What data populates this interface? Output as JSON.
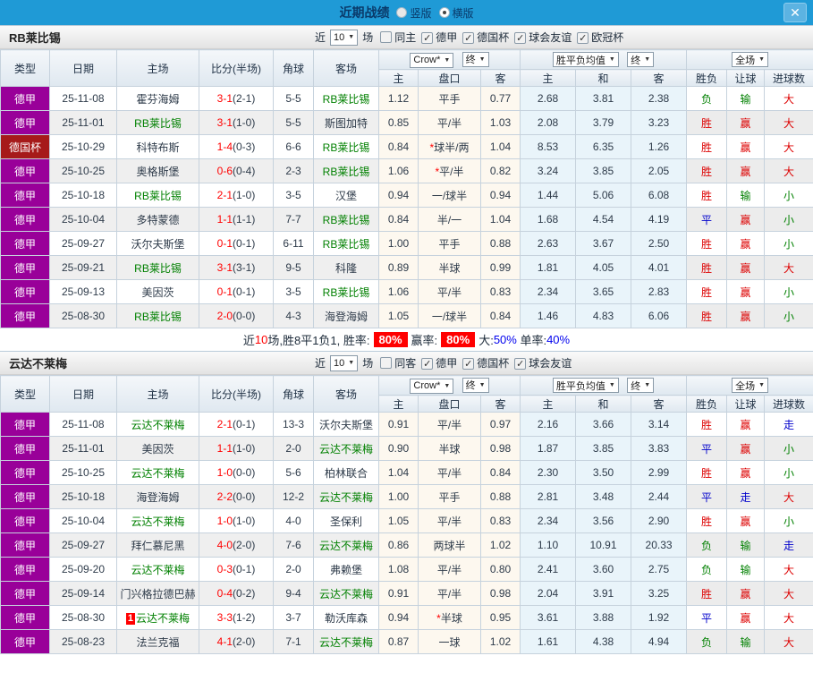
{
  "palette": {
    "header_blue": "#1f9ad6",
    "league_purple": "#990099",
    "cup_darkred": "#a61a1a",
    "win_red": "#dd0000",
    "draw_blue": "#0000cc",
    "lose_green": "#008000",
    "score_red": "#ff0000"
  },
  "header": {
    "title": "近期战绩",
    "vertical": "竖版",
    "horizontal": "横版",
    "close": "✕"
  },
  "controls": {
    "near": "近",
    "count": "10",
    "games": "场",
    "bookmaker": "Crow*",
    "final": "终",
    "mean": "胜平负均值",
    "final2": "终",
    "scope": "全场"
  },
  "cols": {
    "type": "类型",
    "date": "日期",
    "home": "主场",
    "score": "比分(半场)",
    "corners": "角球",
    "away": "客场",
    "odds_home": "主",
    "handicap": "盘口",
    "odds_away": "客",
    "mean_home": "主",
    "mean_draw": "和",
    "mean_away": "客",
    "wdl": "胜负",
    "let_ball": "让球",
    "goals": "进球数"
  },
  "sections": [
    {
      "team": "RB莱比锡",
      "same_label": "同主",
      "leagues": [
        "德甲",
        "德国杯",
        "球会友谊",
        "欧冠杯"
      ],
      "rows": [
        {
          "league": "德甲",
          "badge": "purple",
          "date": "25-11-08",
          "home": "霍芬海姆",
          "home_self": false,
          "home_card": "",
          "score": "3-1",
          "half": "(2-1)",
          "corners": "5-5",
          "away": "RB莱比锡",
          "away_self": true,
          "crow": [
            "1.12",
            "平手",
            "0.77"
          ],
          "mean": [
            "2.68",
            "3.81",
            "2.38"
          ],
          "res": [
            [
              "负",
              "green"
            ],
            [
              "输",
              "green"
            ],
            [
              "大",
              "red"
            ]
          ]
        },
        {
          "league": "德甲",
          "badge": "purple",
          "date": "25-11-01",
          "home": "RB莱比锡",
          "home_self": true,
          "home_card": "",
          "score": "3-1",
          "half": "(1-0)",
          "corners": "5-5",
          "away": "斯图加特",
          "away_self": false,
          "crow": [
            "0.85",
            "平/半",
            "1.03"
          ],
          "mean": [
            "2.08",
            "3.79",
            "3.23"
          ],
          "res": [
            [
              "胜",
              "red"
            ],
            [
              "赢",
              "red"
            ],
            [
              "大",
              "red"
            ]
          ]
        },
        {
          "league": "德国杯",
          "badge": "darkred",
          "date": "25-10-29",
          "home": "科特布斯",
          "home_self": false,
          "home_card": "",
          "score": "1-4",
          "half": "(0-3)",
          "corners": "6-6",
          "away": "RB莱比锡",
          "away_self": true,
          "crow": [
            "0.84",
            "*球半/两",
            "1.04"
          ],
          "mean": [
            "8.53",
            "6.35",
            "1.26"
          ],
          "res": [
            [
              "胜",
              "red"
            ],
            [
              "赢",
              "red"
            ],
            [
              "大",
              "red"
            ]
          ]
        },
        {
          "league": "德甲",
          "badge": "purple",
          "date": "25-10-25",
          "home": "奥格斯堡",
          "home_self": false,
          "home_card": "",
          "score": "0-6",
          "half": "(0-4)",
          "corners": "2-3",
          "away": "RB莱比锡",
          "away_self": true,
          "crow": [
            "1.06",
            "*平/半",
            "0.82"
          ],
          "mean": [
            "3.24",
            "3.85",
            "2.05"
          ],
          "res": [
            [
              "胜",
              "red"
            ],
            [
              "赢",
              "red"
            ],
            [
              "大",
              "red"
            ]
          ]
        },
        {
          "league": "德甲",
          "badge": "purple",
          "date": "25-10-18",
          "home": "RB莱比锡",
          "home_self": true,
          "home_card": "",
          "score": "2-1",
          "half": "(1-0)",
          "corners": "3-5",
          "away": "汉堡",
          "away_self": false,
          "crow": [
            "0.94",
            "一/球半",
            "0.94"
          ],
          "mean": [
            "1.44",
            "5.06",
            "6.08"
          ],
          "res": [
            [
              "胜",
              "red"
            ],
            [
              "输",
              "green"
            ],
            [
              "小",
              "green"
            ]
          ]
        },
        {
          "league": "德甲",
          "badge": "purple",
          "date": "25-10-04",
          "home": "多特蒙德",
          "home_self": false,
          "home_card": "",
          "score": "1-1",
          "half": "(1-1)",
          "corners": "7-7",
          "away": "RB莱比锡",
          "away_self": true,
          "crow": [
            "0.84",
            "半/一",
            "1.04"
          ],
          "mean": [
            "1.68",
            "4.54",
            "4.19"
          ],
          "res": [
            [
              "平",
              "blue"
            ],
            [
              "赢",
              "red"
            ],
            [
              "小",
              "green"
            ]
          ]
        },
        {
          "league": "德甲",
          "badge": "purple",
          "date": "25-09-27",
          "home": "沃尔夫斯堡",
          "home_self": false,
          "home_card": "",
          "score": "0-1",
          "half": "(0-1)",
          "corners": "6-11",
          "away": "RB莱比锡",
          "away_self": true,
          "crow": [
            "1.00",
            "平手",
            "0.88"
          ],
          "mean": [
            "2.63",
            "3.67",
            "2.50"
          ],
          "res": [
            [
              "胜",
              "red"
            ],
            [
              "赢",
              "red"
            ],
            [
              "小",
              "green"
            ]
          ]
        },
        {
          "league": "德甲",
          "badge": "purple",
          "date": "25-09-21",
          "home": "RB莱比锡",
          "home_self": true,
          "home_card": "",
          "score": "3-1",
          "half": "(3-1)",
          "corners": "9-5",
          "away": "科隆",
          "away_self": false,
          "crow": [
            "0.89",
            "半球",
            "0.99"
          ],
          "mean": [
            "1.81",
            "4.05",
            "4.01"
          ],
          "res": [
            [
              "胜",
              "red"
            ],
            [
              "赢",
              "red"
            ],
            [
              "大",
              "red"
            ]
          ]
        },
        {
          "league": "德甲",
          "badge": "purple",
          "date": "25-09-13",
          "home": "美因茨",
          "home_self": false,
          "home_card": "",
          "score": "0-1",
          "half": "(0-1)",
          "corners": "3-5",
          "away": "RB莱比锡",
          "away_self": true,
          "crow": [
            "1.06",
            "平/半",
            "0.83"
          ],
          "mean": [
            "2.34",
            "3.65",
            "2.83"
          ],
          "res": [
            [
              "胜",
              "red"
            ],
            [
              "赢",
              "red"
            ],
            [
              "小",
              "green"
            ]
          ]
        },
        {
          "league": "德甲",
          "badge": "purple",
          "date": "25-08-30",
          "home": "RB莱比锡",
          "home_self": true,
          "home_card": "",
          "score": "2-0",
          "half": "(0-0)",
          "corners": "4-3",
          "away": "海登海姆",
          "away_self": false,
          "crow": [
            "1.05",
            "一/球半",
            "0.84"
          ],
          "mean": [
            "1.46",
            "4.83",
            "6.06"
          ],
          "res": [
            [
              "胜",
              "red"
            ],
            [
              "赢",
              "red"
            ],
            [
              "小",
              "green"
            ]
          ]
        }
      ],
      "summary": [
        [
          "近",
          "dark"
        ],
        [
          "10",
          "red"
        ],
        [
          "场,胜8平1负1, 胜率:",
          "dark"
        ],
        [
          "80%",
          "badge"
        ],
        [
          "赢率:",
          "dark"
        ],
        [
          "80%",
          "badge"
        ],
        [
          "大:",
          "dark"
        ],
        [
          "50%",
          "blue"
        ],
        [
          " 单率:",
          "dark"
        ],
        [
          "40%",
          "blue"
        ]
      ]
    },
    {
      "team": "云达不莱梅",
      "same_label": "同客",
      "leagues": [
        "德甲",
        "德国杯",
        "球会友谊"
      ],
      "rows": [
        {
          "league": "德甲",
          "badge": "purple",
          "date": "25-11-08",
          "home": "云达不莱梅",
          "home_self": true,
          "home_card": "",
          "score": "2-1",
          "half": "(0-1)",
          "corners": "13-3",
          "away": "沃尔夫斯堡",
          "away_self": false,
          "crow": [
            "0.91",
            "平/半",
            "0.97"
          ],
          "mean": [
            "2.16",
            "3.66",
            "3.14"
          ],
          "res": [
            [
              "胜",
              "red"
            ],
            [
              "赢",
              "red"
            ],
            [
              "走",
              "blue"
            ]
          ]
        },
        {
          "league": "德甲",
          "badge": "purple",
          "date": "25-11-01",
          "home": "美因茨",
          "home_self": false,
          "home_card": "",
          "score": "1-1",
          "half": "(1-0)",
          "corners": "2-0",
          "away": "云达不莱梅",
          "away_self": true,
          "crow": [
            "0.90",
            "半球",
            "0.98"
          ],
          "mean": [
            "1.87",
            "3.85",
            "3.83"
          ],
          "res": [
            [
              "平",
              "blue"
            ],
            [
              "赢",
              "red"
            ],
            [
              "小",
              "green"
            ]
          ]
        },
        {
          "league": "德甲",
          "badge": "purple",
          "date": "25-10-25",
          "home": "云达不莱梅",
          "home_self": true,
          "home_card": "",
          "score": "1-0",
          "half": "(0-0)",
          "corners": "5-6",
          "away": "柏林联合",
          "away_self": false,
          "crow": [
            "1.04",
            "平/半",
            "0.84"
          ],
          "mean": [
            "2.30",
            "3.50",
            "2.99"
          ],
          "res": [
            [
              "胜",
              "red"
            ],
            [
              "赢",
              "red"
            ],
            [
              "小",
              "green"
            ]
          ]
        },
        {
          "league": "德甲",
          "badge": "purple",
          "date": "25-10-18",
          "home": "海登海姆",
          "home_self": false,
          "home_card": "",
          "score": "2-2",
          "half": "(0-0)",
          "corners": "12-2",
          "away": "云达不莱梅",
          "away_self": true,
          "crow": [
            "1.00",
            "平手",
            "0.88"
          ],
          "mean": [
            "2.81",
            "3.48",
            "2.44"
          ],
          "res": [
            [
              "平",
              "blue"
            ],
            [
              "走",
              "blue"
            ],
            [
              "大",
              "red"
            ]
          ]
        },
        {
          "league": "德甲",
          "badge": "purple",
          "date": "25-10-04",
          "home": "云达不莱梅",
          "home_self": true,
          "home_card": "",
          "score": "1-0",
          "half": "(1-0)",
          "corners": "4-0",
          "away": "圣保利",
          "away_self": false,
          "crow": [
            "1.05",
            "平/半",
            "0.83"
          ],
          "mean": [
            "2.34",
            "3.56",
            "2.90"
          ],
          "res": [
            [
              "胜",
              "red"
            ],
            [
              "赢",
              "red"
            ],
            [
              "小",
              "green"
            ]
          ]
        },
        {
          "league": "德甲",
          "badge": "purple",
          "date": "25-09-27",
          "home": "拜仁慕尼黑",
          "home_self": false,
          "home_card": "",
          "score": "4-0",
          "half": "(2-0)",
          "corners": "7-6",
          "away": "云达不莱梅",
          "away_self": true,
          "crow": [
            "0.86",
            "两球半",
            "1.02"
          ],
          "mean": [
            "1.10",
            "10.91",
            "20.33"
          ],
          "res": [
            [
              "负",
              "green"
            ],
            [
              "输",
              "green"
            ],
            [
              "走",
              "blue"
            ]
          ]
        },
        {
          "league": "德甲",
          "badge": "purple",
          "date": "25-09-20",
          "home": "云达不莱梅",
          "home_self": true,
          "home_card": "",
          "score": "0-3",
          "half": "(0-1)",
          "corners": "2-0",
          "away": "弗赖堡",
          "away_self": false,
          "crow": [
            "1.08",
            "平/半",
            "0.80"
          ],
          "mean": [
            "2.41",
            "3.60",
            "2.75"
          ],
          "res": [
            [
              "负",
              "green"
            ],
            [
              "输",
              "green"
            ],
            [
              "大",
              "red"
            ]
          ]
        },
        {
          "league": "德甲",
          "badge": "purple",
          "date": "25-09-14",
          "home": "门兴格拉德巴赫",
          "home_self": false,
          "home_card": "",
          "score": "0-4",
          "half": "(0-2)",
          "corners": "9-4",
          "away": "云达不莱梅",
          "away_self": true,
          "crow": [
            "0.91",
            "平/半",
            "0.98"
          ],
          "mean": [
            "2.04",
            "3.91",
            "3.25"
          ],
          "res": [
            [
              "胜",
              "red"
            ],
            [
              "赢",
              "red"
            ],
            [
              "大",
              "red"
            ]
          ]
        },
        {
          "league": "德甲",
          "badge": "purple",
          "date": "25-08-30",
          "home": "云达不莱梅",
          "home_self": true,
          "home_card": "1",
          "score": "3-3",
          "half": "(1-2)",
          "corners": "3-7",
          "away": "勒沃库森",
          "away_self": false,
          "crow": [
            "0.94",
            "*半球",
            "0.95"
          ],
          "mean": [
            "3.61",
            "3.88",
            "1.92"
          ],
          "res": [
            [
              "平",
              "blue"
            ],
            [
              "赢",
              "red"
            ],
            [
              "大",
              "red"
            ]
          ]
        },
        {
          "league": "德甲",
          "badge": "purple",
          "date": "25-08-23",
          "home": "法兰克福",
          "home_self": false,
          "home_card": "",
          "score": "4-1",
          "half": "(2-0)",
          "corners": "7-1",
          "away": "云达不莱梅",
          "away_self": true,
          "crow": [
            "0.87",
            "一球",
            "1.02"
          ],
          "mean": [
            "1.61",
            "4.38",
            "4.94"
          ],
          "res": [
            [
              "负",
              "green"
            ],
            [
              "输",
              "green"
            ],
            [
              "大",
              "red"
            ]
          ]
        }
      ],
      "summary": []
    }
  ]
}
